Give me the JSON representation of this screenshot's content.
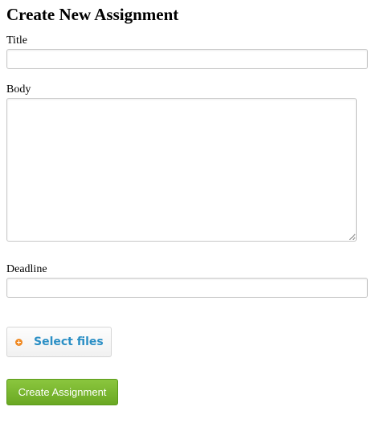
{
  "page": {
    "title": "Create New Assignment"
  },
  "form": {
    "title_label": "Title",
    "title_value": "",
    "body_label": "Body",
    "body_value": "",
    "deadline_label": "Deadline",
    "deadline_value": "",
    "select_files_label": "Select files",
    "select_files_icon": "plus-circle-icon",
    "submit_label": "Create Assignment"
  },
  "colors": {
    "accent_orange": "#f08a24",
    "link_blue": "#2b8fc5",
    "submit_green": "#7ab82f"
  }
}
